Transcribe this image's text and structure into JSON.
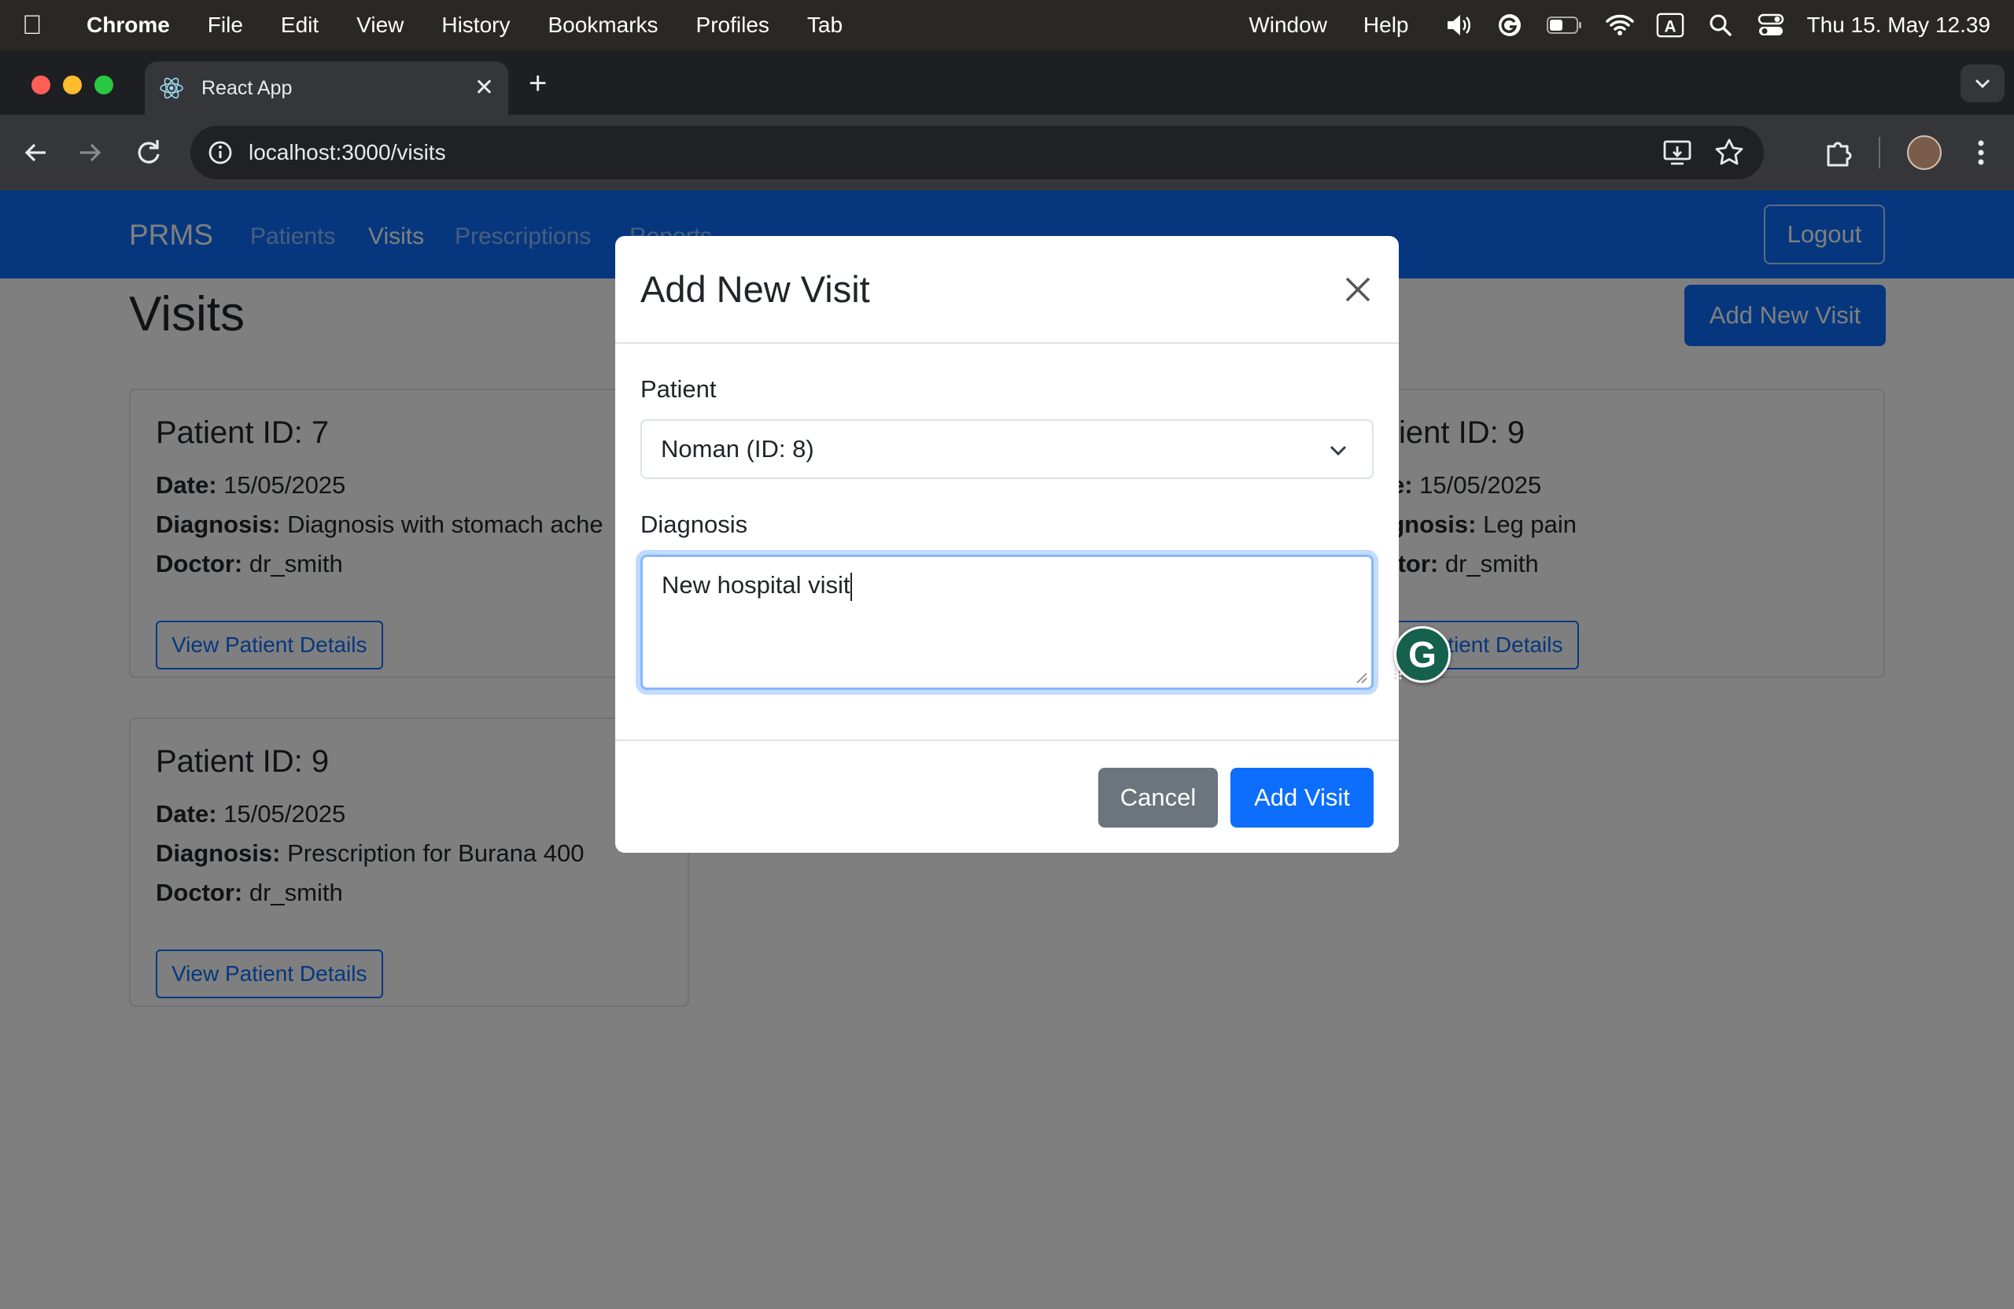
{
  "menubar": {
    "app_name": "Chrome",
    "items": [
      "File",
      "Edit",
      "View",
      "History",
      "Bookmarks",
      "Profiles",
      "Tab"
    ],
    "right_items": [
      "Window",
      "Help"
    ],
    "datetime": "Thu 15. May  12.39"
  },
  "browser": {
    "tab_title": "React App",
    "url": "localhost:3000/visits"
  },
  "app": {
    "brand": "PRMS",
    "nav": [
      "Patients",
      "Visits",
      "Prescriptions",
      "Reports"
    ],
    "logout": "Logout",
    "page_title": "Visits",
    "add_button": "Add New Visit",
    "colors": {
      "primary": "#0d6efd",
      "secondary": "#6c757d"
    }
  },
  "visits": [
    {
      "title": "Patient ID: 7",
      "date_label": "Date:",
      "date": "15/05/2025",
      "diagnosis_label": "Diagnosis:",
      "diagnosis": "Diagnosis with stomach ache",
      "doctor_label": "Doctor:",
      "doctor": "dr_smith",
      "button": "View Patient Details"
    },
    {
      "title": "Patient ID: 9",
      "date_label": "Date:",
      "date": "15/05/2025",
      "diagnosis_label": "Diagnosis:",
      "diagnosis": "Leg pain",
      "doctor_label": "Doctor:",
      "doctor": "dr_smith",
      "button": "View Patient Details"
    },
    {
      "title": "Patient ID: 9",
      "date_label": "Date:",
      "date": "15/05/2025",
      "diagnosis_label": "Diagnosis:",
      "diagnosis": "Prescription for Burana 400",
      "doctor_label": "Doctor:",
      "doctor": "dr_smith",
      "button": "View Patient Details"
    }
  ],
  "modal": {
    "title": "Add New Visit",
    "patient_label": "Patient",
    "patient_selected": "Noman (ID: 8)",
    "diagnosis_label": "Diagnosis",
    "diagnosis_value": "New hospital visit",
    "cancel": "Cancel",
    "submit": "Add Visit"
  },
  "grammarly": {
    "letter": "G"
  }
}
